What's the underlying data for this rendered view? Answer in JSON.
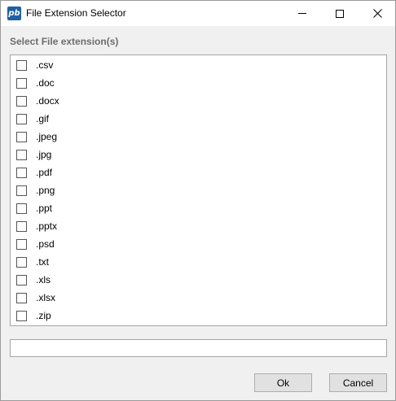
{
  "window": {
    "title": "File Extension Selector",
    "app_icon_text": "pb",
    "controls": {
      "minimize": "minimize-icon",
      "maximize": "maximize-icon",
      "close": "close-icon",
      "close_glyph": "✕"
    }
  },
  "heading": "Select File extension(s)",
  "extensions": [
    {
      "label": ".csv",
      "checked": false
    },
    {
      "label": ".doc",
      "checked": false
    },
    {
      "label": ".docx",
      "checked": false
    },
    {
      "label": ".gif",
      "checked": false
    },
    {
      "label": ".jpeg",
      "checked": false
    },
    {
      "label": ".jpg",
      "checked": false
    },
    {
      "label": ".pdf",
      "checked": false
    },
    {
      "label": ".png",
      "checked": false
    },
    {
      "label": ".ppt",
      "checked": false
    },
    {
      "label": ".pptx",
      "checked": false
    },
    {
      "label": ".psd",
      "checked": false
    },
    {
      "label": ".txt",
      "checked": false
    },
    {
      "label": ".xls",
      "checked": false
    },
    {
      "label": ".xlsx",
      "checked": false
    },
    {
      "label": ".zip",
      "checked": false
    }
  ],
  "selection_field": {
    "value": ""
  },
  "buttons": {
    "ok": "Ok",
    "cancel": "Cancel"
  },
  "colors": {
    "app_icon": "#1f5fa8",
    "heading": "#6d6d6d"
  }
}
